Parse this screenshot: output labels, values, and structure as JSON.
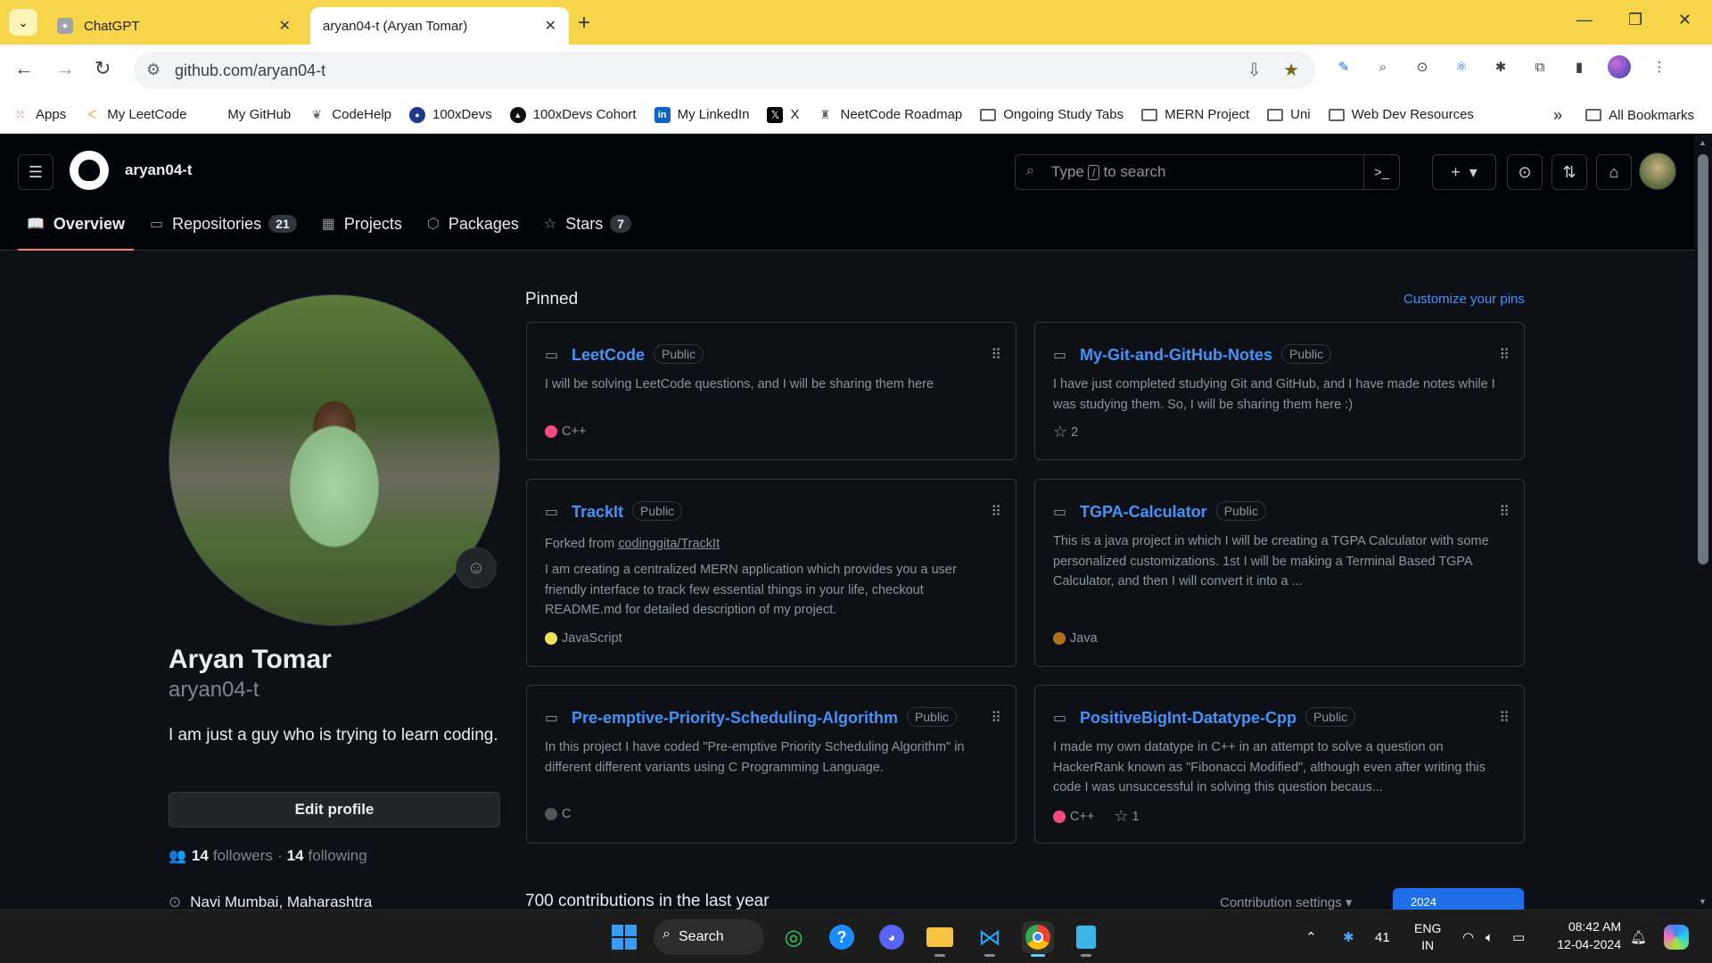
{
  "browser": {
    "tabs": [
      {
        "title": "ChatGPT",
        "active": false
      },
      {
        "title": "aryan04-t (Aryan Tomar)",
        "active": true
      }
    ],
    "url": "github.com/aryan04-t",
    "bookmarks": [
      {
        "label": "Apps",
        "icon": "apps-grid-icon"
      },
      {
        "label": "My LeetCode",
        "icon": "leetcode-icon"
      },
      {
        "label": "My GitHub",
        "icon": "github-icon"
      },
      {
        "label": "CodeHelp",
        "icon": "codehelp-icon"
      },
      {
        "label": "100xDevs",
        "icon": "100xdevs-icon"
      },
      {
        "label": "100xDevs Cohort",
        "icon": "100xdevs-cohort-icon"
      },
      {
        "label": "My LinkedIn",
        "icon": "linkedin-icon"
      },
      {
        "label": "X",
        "icon": "x-icon"
      },
      {
        "label": "NeetCode Roadmap",
        "icon": "neetcode-icon"
      },
      {
        "label": "Ongoing Study Tabs",
        "icon": "folder-icon"
      },
      {
        "label": "MERN Project",
        "icon": "folder-icon"
      },
      {
        "label": "Uni",
        "icon": "folder-icon"
      },
      {
        "label": "Web Dev Resources",
        "icon": "folder-icon"
      }
    ],
    "all_bookmarks": "All Bookmarks"
  },
  "header": {
    "username": "aryan04-t",
    "search_placeholder_pre": "Type",
    "search_key": "/",
    "search_placeholder_post": "to search"
  },
  "nav_tabs": [
    {
      "label": "Overview",
      "count": null,
      "icon": "book-icon",
      "selected": true
    },
    {
      "label": "Repositories",
      "count": "21",
      "icon": "repo-icon",
      "selected": false
    },
    {
      "label": "Projects",
      "count": null,
      "icon": "table-icon",
      "selected": false
    },
    {
      "label": "Packages",
      "count": null,
      "icon": "package-icon",
      "selected": false
    },
    {
      "label": "Stars",
      "count": "7",
      "icon": "star-icon",
      "selected": false
    }
  ],
  "profile": {
    "name": "Aryan Tomar",
    "login": "aryan04-t",
    "bio": "I am just a guy who is trying to learn coding.",
    "edit_label": "Edit profile",
    "followers_count": "14",
    "followers_label": "followers",
    "separator": "·",
    "following_count": "14",
    "following_label": "following",
    "location": "Navi Mumbai, Maharashtra"
  },
  "pinned": {
    "title": "Pinned",
    "customize_label": "Customize your pins",
    "repos": [
      {
        "name": "LeetCode",
        "visibility": "Public",
        "forked_from": null,
        "description": "I will be solving LeetCode questions, and I will be sharing them here",
        "language": "C++",
        "lang_color": "#f34b7d",
        "stars": null
      },
      {
        "name": "My-Git-and-GitHub-Notes",
        "visibility": "Public",
        "forked_from": null,
        "description": "I have just completed studying Git and GitHub, and I have made notes while I was studying them. So, I will be sharing them here :)",
        "language": null,
        "lang_color": null,
        "stars": "2"
      },
      {
        "name": "TrackIt",
        "visibility": "Public",
        "forked_from": "codinggita/TrackIt",
        "forked_prefix": "Forked from",
        "description": "I am creating a centralized MERN application which provides you a user friendly interface to track few essential things in your life, checkout README.md for detailed description of my project.",
        "language": "JavaScript",
        "lang_color": "#f1e05a",
        "stars": null
      },
      {
        "name": "TGPA-Calculator",
        "visibility": "Public",
        "forked_from": null,
        "description": "This is a java project in which I will be creating a TGPA Calculator with some personalized customizations. 1st I will be making a Terminal Based TGPA Calculator, and then I will convert it into a ...",
        "language": "Java",
        "lang_color": "#b07219",
        "stars": null
      },
      {
        "name": "Pre-emptive-Priority-Scheduling-Algorithm",
        "visibility": "Public",
        "forked_from": null,
        "description": "In this project I have coded \"Pre-emptive Priority Scheduling Algorithm\" in different different variants using C Programming Language.",
        "language": "C",
        "lang_color": "#555555",
        "stars": null
      },
      {
        "name": "PositiveBigInt-Datatype-Cpp",
        "visibility": "Public",
        "forked_from": null,
        "description": "I made my own datatype in C++ in an attempt to solve a question on HackerRank known as \"Fibonacci Modified\", although even after writing this code I was unsuccessful in solving this question becaus...",
        "language": "C++",
        "lang_color": "#f34b7d",
        "stars": "1"
      }
    ]
  },
  "contributions": {
    "title": "700 contributions in the last year",
    "settings_label": "Contribution settings",
    "year": "2024"
  },
  "taskbar": {
    "search_label": "Search",
    "lang_line1": "ENG",
    "lang_line2": "IN",
    "weather": "41",
    "time": "08:42 AM",
    "date": "12-04-2024"
  }
}
